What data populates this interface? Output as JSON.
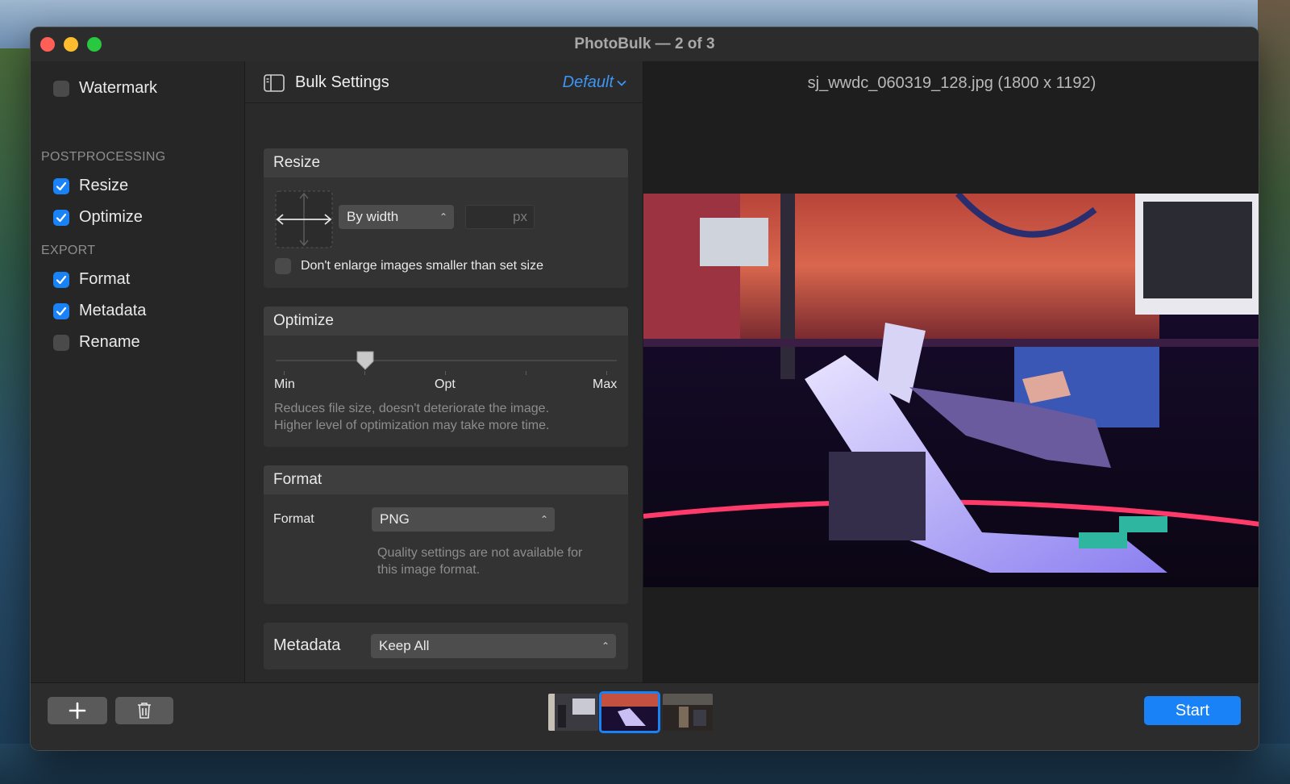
{
  "window": {
    "title": "PhotoBulk — 2 of 3"
  },
  "sidebar": {
    "watermark": {
      "label": "Watermark",
      "checked": false
    },
    "postprocessing_header": "POSTPROCESSING",
    "resize": {
      "label": "Resize",
      "checked": true
    },
    "optimize": {
      "label": "Optimize",
      "checked": true
    },
    "export_header": "EXPORT",
    "format": {
      "label": "Format",
      "checked": true
    },
    "metadata": {
      "label": "Metadata",
      "checked": true
    },
    "rename": {
      "label": "Rename",
      "checked": false
    }
  },
  "settings": {
    "title": "Bulk Settings",
    "preset": "Default",
    "resize": {
      "header": "Resize",
      "mode": "By width",
      "value": "",
      "value_placeholder": "px",
      "dont_enlarge_label": "Don't enlarge images smaller than set size",
      "dont_enlarge_checked": false
    },
    "optimize": {
      "header": "Optimize",
      "level": 0.25,
      "min_label": "Min",
      "opt_label": "Opt",
      "max_label": "Max",
      "desc_line1": "Reduces file size, doesn't deteriorate the image.",
      "desc_line2": "Higher level of optimization may take more time."
    },
    "format": {
      "header": "Format",
      "field_label": "Format",
      "value": "PNG",
      "note_line1": "Quality settings are not available for",
      "note_line2": "this image format."
    },
    "metadata": {
      "label": "Metadata",
      "value": "Keep All"
    }
  },
  "preview": {
    "filename": "sj_wwdc_060319_128.jpg (1800 x 1192)"
  },
  "bottom": {
    "start_label": "Start",
    "selected_thumb": 2,
    "accent": "#1a82f7"
  }
}
